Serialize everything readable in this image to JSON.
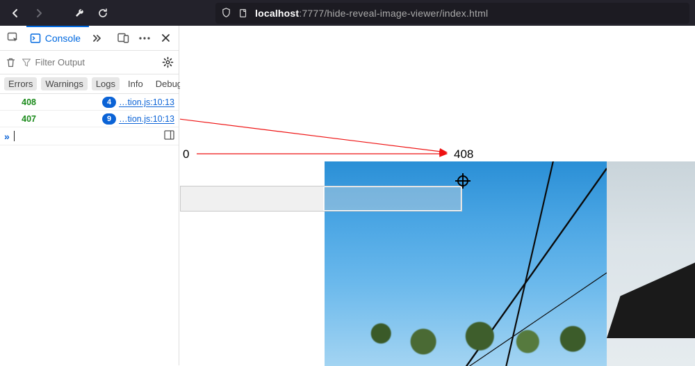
{
  "browser": {
    "url_host": "localhost",
    "url_port": ":7777",
    "url_path": "/hide-reveal-image-viewer/index.html"
  },
  "devtools": {
    "console_tab_label": "Console",
    "filter_placeholder": "Filter Output",
    "categories": {
      "errors": "Errors",
      "warnings": "Warnings",
      "logs": "Logs",
      "info": "Info",
      "debug": "Debug"
    },
    "log_lines": [
      {
        "value": "408",
        "count": "4",
        "source": "…tion.js:10:13"
      },
      {
        "value": "407",
        "count": "9",
        "source": "…tion.js:10:13"
      }
    ]
  },
  "viewport": {
    "offset_label_start": "0",
    "offset_label_end": "408"
  }
}
